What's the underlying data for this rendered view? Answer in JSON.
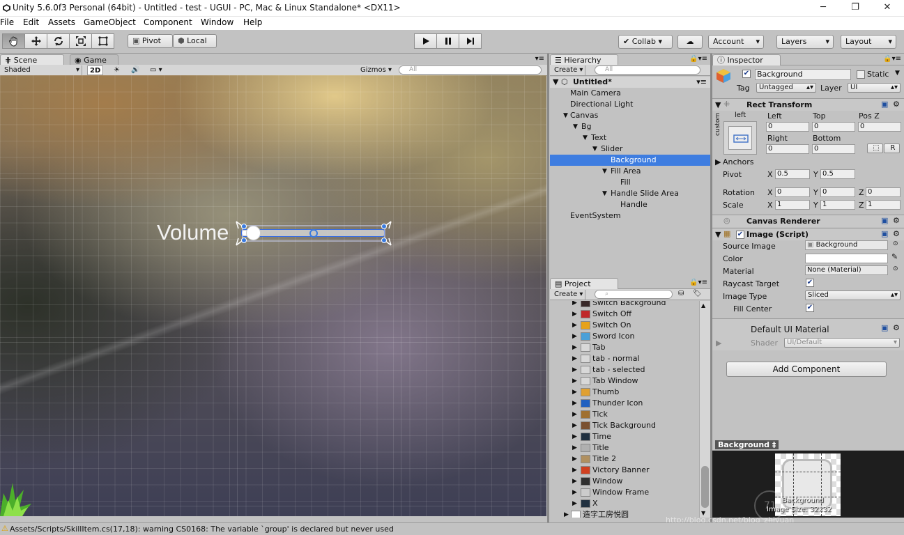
{
  "window": {
    "title": "Unity 5.6.0f3 Personal (64bit) - Untitled - test - UGUI - PC, Mac & Linux Standalone* <DX11>",
    "minimize": "─",
    "maximize": "❐",
    "close": "✕"
  },
  "menu": [
    "File",
    "Edit",
    "Assets",
    "GameObject",
    "Component",
    "Window",
    "Help"
  ],
  "toolbar": {
    "tools": [
      "hand-icon",
      "move-icon",
      "rotate-icon",
      "scale-icon",
      "rect-tool-icon"
    ],
    "pivot": "Pivot",
    "local": "Local",
    "collab": "Collab ▾",
    "account": "Account",
    "layers": "Layers",
    "layout": "Layout"
  },
  "scene": {
    "tabs": [
      "Scene",
      "Game"
    ],
    "shading": "Shaded",
    "mode2d": "2D",
    "gizmos": "Gizmos",
    "search_placeholder": "All",
    "volume_label": "Volume",
    "slider_value": 0.05
  },
  "hierarchy": {
    "title": "Hierarchy",
    "create": "Create",
    "search_placeholder": "All",
    "scene_name": "Untitled*",
    "items": [
      {
        "label": "Main Camera",
        "depth": 1,
        "arrow": ""
      },
      {
        "label": "Directional Light",
        "depth": 1,
        "arrow": ""
      },
      {
        "label": "Canvas",
        "depth": 1,
        "arrow": "▼"
      },
      {
        "label": "Bg",
        "depth": 2,
        "arrow": "▼"
      },
      {
        "label": "Text",
        "depth": 3,
        "arrow": "▼"
      },
      {
        "label": "Slider",
        "depth": 4,
        "arrow": "▼"
      },
      {
        "label": "Background",
        "depth": 5,
        "arrow": "",
        "selected": true
      },
      {
        "label": "Fill Area",
        "depth": 5,
        "arrow": "▼"
      },
      {
        "label": "Fill",
        "depth": 6,
        "arrow": ""
      },
      {
        "label": "Handle Slide Area",
        "depth": 5,
        "arrow": "▼"
      },
      {
        "label": "Handle",
        "depth": 6,
        "arrow": ""
      },
      {
        "label": "EventSystem",
        "depth": 1,
        "arrow": ""
      }
    ]
  },
  "project": {
    "title": "Project",
    "create": "Create",
    "items": [
      {
        "label": "Switch Background",
        "icon": "#3a2a2a"
      },
      {
        "label": "Switch Off",
        "icon": "#c0282a"
      },
      {
        "label": "Switch On",
        "icon": "#e6a21a"
      },
      {
        "label": "Sword Icon",
        "icon": "#4aa0d8"
      },
      {
        "label": "Tab",
        "icon": "#d8d8d8"
      },
      {
        "label": "tab - normal",
        "icon": "#d8d8d8"
      },
      {
        "label": "tab - selected",
        "icon": "#d8d8d8"
      },
      {
        "label": "Tab Window",
        "icon": "#d8d8d8"
      },
      {
        "label": "Thumb",
        "icon": "#e0a030"
      },
      {
        "label": "Thunder Icon",
        "icon": "#2060c0"
      },
      {
        "label": "Tick",
        "icon": "#a07030"
      },
      {
        "label": "Tick Background",
        "icon": "#7a5030"
      },
      {
        "label": "Time",
        "icon": "#203040"
      },
      {
        "label": "Title",
        "icon": "#b0b0b0"
      },
      {
        "label": "Title 2",
        "icon": "#b09060"
      },
      {
        "label": "Victory Banner",
        "icon": "#d04020"
      },
      {
        "label": "Window",
        "icon": "#303030"
      },
      {
        "label": "Window Frame",
        "icon": "#cccccc"
      },
      {
        "label": "X",
        "icon": "#203040"
      },
      {
        "label": "造字工房悦圆",
        "icon": "#ffffff"
      }
    ]
  },
  "inspector": {
    "title": "Inspector",
    "object_name": "Background",
    "static": "Static",
    "tag_label": "Tag",
    "tag": "Untagged",
    "layer_label": "Layer",
    "layer": "UI",
    "rect_transform": {
      "title": "Rect Transform",
      "anchor_h": "left",
      "anchor_v": "custom",
      "left_label": "Left",
      "left": "0",
      "top_label": "Top",
      "top": "0",
      "posz_label": "Pos Z",
      "posz": "0",
      "right_label": "Right",
      "right": "0",
      "bottom_label": "Bottom",
      "bottom": "0",
      "blueprint": "⬚",
      "raw": "R",
      "anchors": "Anchors",
      "pivot_label": "Pivot",
      "pivot_x": "0.5",
      "pivot_y": "0.5",
      "rotation_label": "Rotation",
      "rot_x": "0",
      "rot_y": "0",
      "rot_z": "0",
      "scale_label": "Scale",
      "scale_x": "1",
      "scale_y": "1",
      "scale_z": "1",
      "x": "X",
      "y": "Y",
      "z": "Z"
    },
    "canvas_renderer": "Canvas Renderer",
    "image": {
      "title": "Image (Script)",
      "source_label": "Source Image",
      "source": "Background",
      "color_label": "Color",
      "material_label": "Material",
      "material": "None (Material)",
      "raycast_label": "Raycast Target",
      "type_label": "Image Type",
      "type": "Sliced",
      "fill_label": "Fill Center"
    },
    "material_block": {
      "title": "Default UI Material",
      "shader_label": "Shader",
      "shader": "UI/Default"
    },
    "add_component": "Add Component",
    "preview_title": "Background ‡",
    "preview_name": "Background",
    "preview_size": "Image Size: 32x32",
    "watermark": "http://blog.csdn.net/blog_zhiyuan",
    "watermark_logo": "71"
  },
  "status": "Assets/Scripts/SkillItem.cs(17,18): warning CS0168: The variable `group' is declared but never used"
}
